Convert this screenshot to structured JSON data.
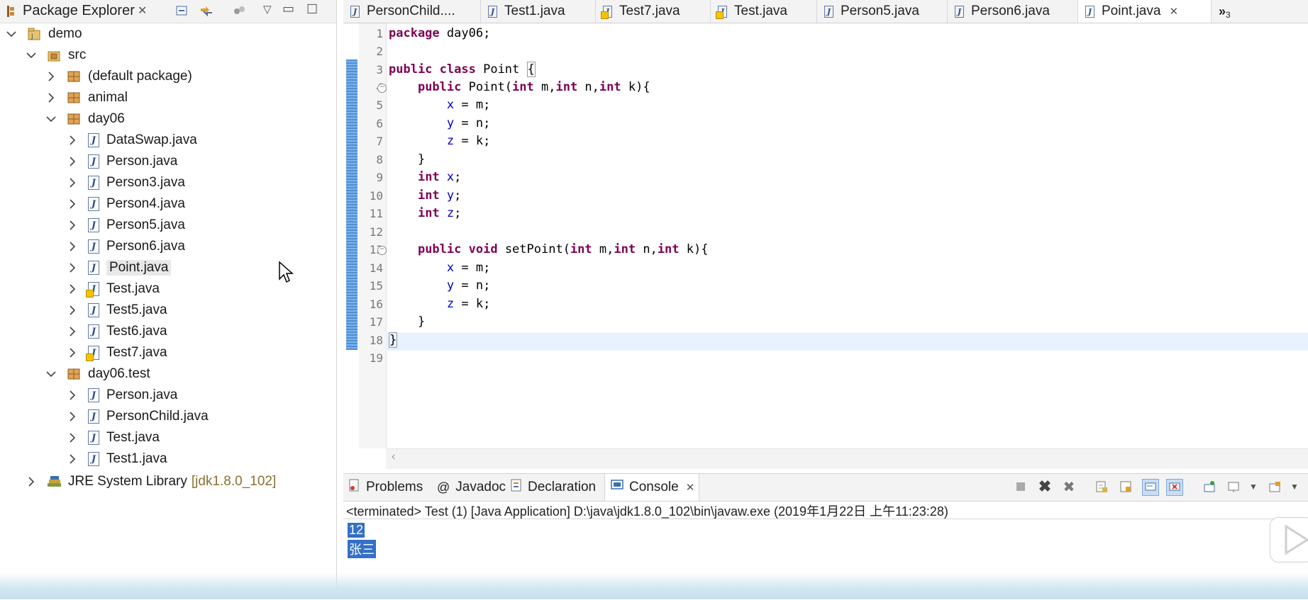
{
  "explorer": {
    "title": "Package Explorer",
    "tree": [
      {
        "label": "demo",
        "kind": "project",
        "expanded": true
      },
      {
        "label": "src",
        "kind": "source-folder",
        "expanded": true
      },
      {
        "label": "(default package)",
        "kind": "package",
        "expanded": false
      },
      {
        "label": "animal",
        "kind": "package",
        "expanded": false
      },
      {
        "label": "day06",
        "kind": "package",
        "expanded": true
      },
      {
        "label": "DataSwap.java",
        "kind": "java-file",
        "warning": false
      },
      {
        "label": "Person.java",
        "kind": "java-file",
        "warning": false
      },
      {
        "label": "Person3.java",
        "kind": "java-file",
        "warning": false
      },
      {
        "label": "Person4.java",
        "kind": "java-file",
        "warning": false
      },
      {
        "label": "Person5.java",
        "kind": "java-file",
        "warning": false
      },
      {
        "label": "Person6.java",
        "kind": "java-file",
        "warning": false
      },
      {
        "label": "Point.java",
        "kind": "java-file",
        "warning": false,
        "selected": true
      },
      {
        "label": "Test.java",
        "kind": "java-file",
        "warning": true
      },
      {
        "label": "Test5.java",
        "kind": "java-file",
        "warning": false
      },
      {
        "label": "Test6.java",
        "kind": "java-file",
        "warning": false
      },
      {
        "label": "Test7.java",
        "kind": "java-file",
        "warning": true
      },
      {
        "label": "day06.test",
        "kind": "package",
        "expanded": true
      },
      {
        "label": "Person.java",
        "kind": "java-file",
        "warning": false
      },
      {
        "label": "PersonChild.java",
        "kind": "java-file",
        "warning": false
      },
      {
        "label": "Test.java",
        "kind": "java-file",
        "warning": false
      },
      {
        "label": "Test1.java",
        "kind": "java-file",
        "warning": false
      },
      {
        "label": "JRE System Library",
        "kind": "library",
        "expanded": false,
        "version": "[jdk1.8.0_102]"
      }
    ]
  },
  "editor": {
    "tabs": [
      {
        "label": "PersonChild....",
        "active": false,
        "warning": false
      },
      {
        "label": "Test1.java",
        "active": false,
        "warning": false
      },
      {
        "label": "Test7.java",
        "active": false,
        "warning": true
      },
      {
        "label": "Test.java",
        "active": false,
        "warning": true
      },
      {
        "label": "Person5.java",
        "active": false,
        "warning": false
      },
      {
        "label": "Person6.java",
        "active": false,
        "warning": false
      },
      {
        "label": "Point.java",
        "active": true,
        "warning": false
      }
    ],
    "overflow_label": "»",
    "overflow_count": "3",
    "line_numbers": [
      "1",
      "2",
      "3",
      "4",
      "5",
      "6",
      "7",
      "8",
      "9",
      "10",
      "11",
      "12",
      "13",
      "14",
      "15",
      "16",
      "17",
      "18",
      "19"
    ],
    "fold_markers": [
      "4",
      "13"
    ]
  },
  "console": {
    "tabs": [
      {
        "label": "Problems",
        "active": false
      },
      {
        "label": "Javadoc",
        "active": false
      },
      {
        "label": "Declaration",
        "active": false
      },
      {
        "label": "Console",
        "active": true
      }
    ],
    "status": "<terminated> Test (1) [Java Application] D:\\java\\jdk1.8.0_102\\bin\\javaw.exe (2019年1月22日 上午11:23:28)",
    "output": [
      "12",
      "张三"
    ]
  },
  "colors": {
    "keyword": "#7f0055",
    "field": "#0000c0",
    "selection": "#3370c8",
    "change_bar": "#4f8fd3"
  }
}
